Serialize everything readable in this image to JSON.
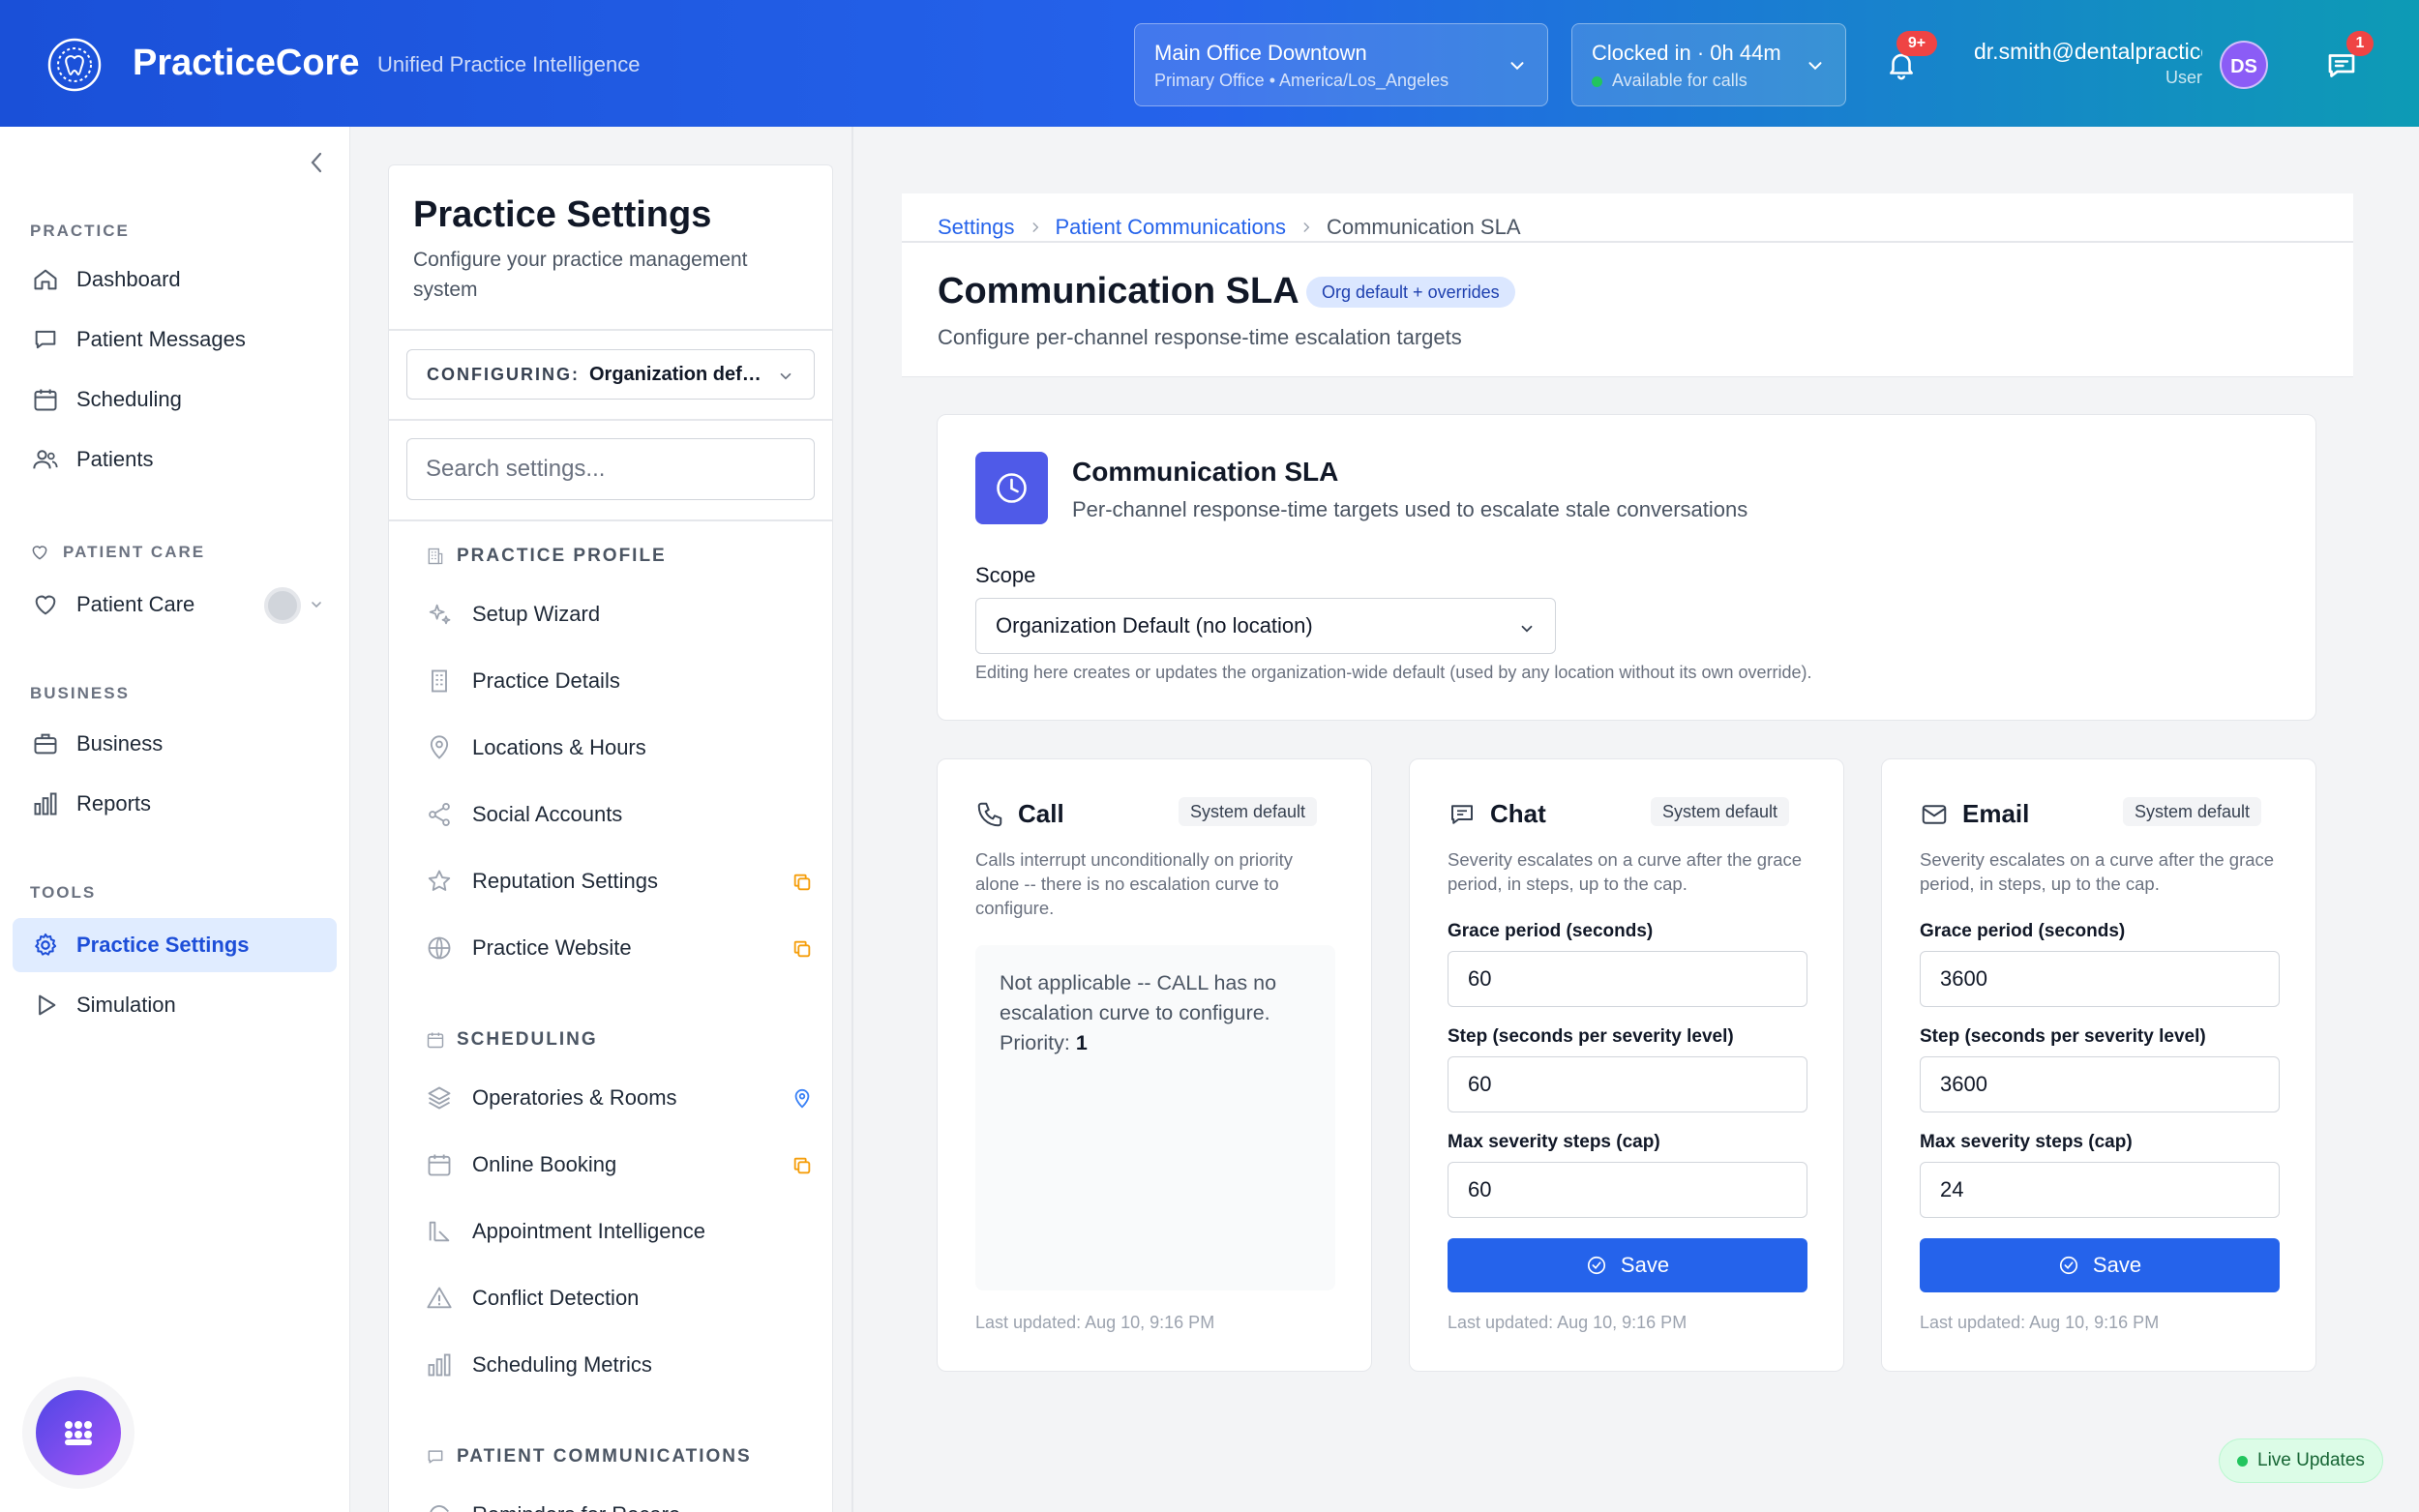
{
  "header": {
    "brand": "PracticeCore",
    "tagline": "Unified Practice Intelligence",
    "location": {
      "name": "Main Office Downtown",
      "detail": "Primary Office • America/Los_Angeles"
    },
    "clock": {
      "status": "Clocked in · 0h 44m",
      "availability": "Available for calls"
    },
    "notifications_badge": "9+",
    "user": {
      "email": "dr.smith@dentalpractice.com",
      "role": "User",
      "initials": "DS"
    },
    "messages_badge": "1"
  },
  "sidebar": {
    "sections": {
      "practice": "PRACTICE",
      "patient_care": "PATIENT CARE",
      "business": "BUSINESS",
      "tools": "TOOLS"
    },
    "items": {
      "dashboard": "Dashboard",
      "patient_messages": "Patient Messages",
      "scheduling": "Scheduling",
      "patients": "Patients",
      "patient_care": "Patient Care",
      "business": "Business",
      "reports": "Reports",
      "practice_settings": "Practice Settings",
      "simulation": "Simulation"
    }
  },
  "settings_panel": {
    "title": "Practice Settings",
    "subtitle": "Configure your practice management system",
    "configuring_label": "CONFIGURING:",
    "configuring_value": "Organization default",
    "search_placeholder": "Search settings...",
    "groups": {
      "practice_profile": "PRACTICE PROFILE",
      "scheduling": "SCHEDULING",
      "patient_communications": "PATIENT COMMUNICATIONS"
    },
    "items": {
      "setup_wizard": "Setup Wizard",
      "practice_details": "Practice Details",
      "locations_hours": "Locations & Hours",
      "social_accounts": "Social Accounts",
      "reputation_settings": "Reputation Settings",
      "practice_website": "Practice Website",
      "operatories_rooms": "Operatories & Rooms",
      "online_booking": "Online Booking",
      "appointment_intelligence": "Appointment Intelligence",
      "conflict_detection": "Conflict Detection",
      "scheduling_metrics": "Scheduling Metrics",
      "reminders_for_recare": "Reminders for Recare"
    }
  },
  "main": {
    "breadcrumb": {
      "settings": "Settings",
      "patient_communications": "Patient Communications",
      "current": "Communication SLA"
    },
    "title": "Communication SLA",
    "badge": "Org default + overrides",
    "subtitle": "Configure per-channel response-time escalation targets",
    "sla_card": {
      "title": "Communication SLA",
      "subtitle": "Per-channel response-time targets used to escalate stale conversations",
      "scope_label": "Scope",
      "scope_value": "Organization Default (no location)",
      "scope_help": "Editing here creates or updates the organization-wide default (used by any location without its own override)."
    },
    "channels": {
      "call": {
        "name": "Call",
        "badge": "System default",
        "description": "Calls interrupt unconditionally on priority alone -- there is no escalation curve to configure.",
        "na_text": "Not applicable -- CALL has no escalation curve to configure.",
        "priority_label": "Priority:",
        "priority_value": "1",
        "last_updated": "Last updated: Aug 10, 9:16 PM"
      },
      "chat": {
        "name": "Chat",
        "badge": "System default",
        "description": "Severity escalates on a curve after the grace period, in steps, up to the cap.",
        "grace_label": "Grace period (seconds)",
        "grace_value": "60",
        "step_label": "Step (seconds per severity level)",
        "step_value": "60",
        "max_label": "Max severity steps (cap)",
        "max_value": "60",
        "save_label": "Save",
        "last_updated": "Last updated: Aug 10, 9:16 PM"
      },
      "email": {
        "name": "Email",
        "badge": "System default",
        "description": "Severity escalates on a curve after the grace period, in steps, up to the cap.",
        "grace_label": "Grace period (seconds)",
        "grace_value": "3600",
        "step_label": "Step (seconds per severity level)",
        "step_value": "3600",
        "max_label": "Max severity steps (cap)",
        "max_value": "24",
        "save_label": "Save",
        "last_updated": "Last updated: Aug 10, 9:16 PM"
      }
    }
  },
  "live_updates": "Live Updates",
  "colors": {
    "primary": "#2563eb",
    "sla_icon": "#4f5ae8",
    "badge_red": "#ef4444",
    "live_green": "#22c55e",
    "orange_tag": "#f59e0b"
  }
}
